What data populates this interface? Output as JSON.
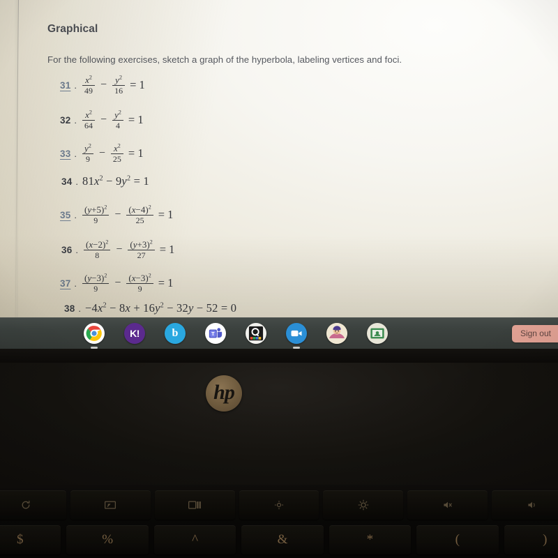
{
  "document": {
    "heading": "Graphical",
    "instruction": "For the following exercises, sketch a graph of the hyperbola, labeling vertices and foci.",
    "exercises": [
      {
        "number": "31",
        "is_link": true,
        "type": "fraction",
        "left": {
          "num": "x²",
          "den": "49",
          "num_var": "x",
          "num_exp": "2"
        },
        "operator": "−",
        "right": {
          "num": "y²",
          "den": "16",
          "num_var": "y",
          "num_exp": "2"
        },
        "rhs": "= 1",
        "latex": "x^2/49 - y^2/16 = 1"
      },
      {
        "number": "32",
        "is_link": false,
        "type": "fraction",
        "left": {
          "num": "x²",
          "den": "64",
          "num_var": "x",
          "num_exp": "2"
        },
        "operator": "−",
        "right": {
          "num": "y²",
          "den": "4",
          "num_var": "y",
          "num_exp": "2"
        },
        "rhs": "= 1",
        "latex": "x^2/64 - y^2/4 = 1"
      },
      {
        "number": "33",
        "is_link": true,
        "type": "fraction",
        "left": {
          "num": "y²",
          "den": "9",
          "num_var": "y",
          "num_exp": "2"
        },
        "operator": "−",
        "right": {
          "num": "x²",
          "den": "25",
          "num_var": "x",
          "num_exp": "2"
        },
        "rhs": "= 1",
        "latex": "y^2/9 - x^2/25 = 1"
      },
      {
        "number": "34",
        "is_link": false,
        "type": "plain",
        "expression": "81x² − 9y² = 1",
        "latex": "81x^2 - 9y^2 = 1"
      },
      {
        "number": "35",
        "is_link": true,
        "type": "fraction",
        "left": {
          "num": "(y+5)²",
          "den": "9",
          "num_base": "(y+5)",
          "num_exp": "2"
        },
        "operator": "−",
        "right": {
          "num": "(x−4)²",
          "den": "25",
          "num_base": "(x−4)",
          "num_exp": "2"
        },
        "rhs": "= 1",
        "latex": "(y+5)^2/9 - (x-4)^2/25 = 1"
      },
      {
        "number": "36",
        "is_link": false,
        "type": "fraction",
        "left": {
          "num": "(x−2)²",
          "den": "8",
          "num_base": "(x−2)",
          "num_exp": "2"
        },
        "operator": "−",
        "right": {
          "num": "(y+3)²",
          "den": "27",
          "num_base": "(y+3)",
          "num_exp": "2"
        },
        "rhs": "= 1",
        "latex": "(x-2)^2/8 - (y+3)^2/27 = 1"
      },
      {
        "number": "37",
        "is_link": true,
        "type": "fraction",
        "left": {
          "num": "(y−3)²",
          "den": "9",
          "num_base": "(y−3)",
          "num_exp": "2"
        },
        "operator": "−",
        "right": {
          "num": "(x−3)²",
          "den": "9",
          "num_base": "(x−3)",
          "num_exp": "2"
        },
        "rhs": "= 1",
        "latex": "(y-3)^2/9 - (x-3)^2/9 = 1"
      },
      {
        "number": "38",
        "is_link": false,
        "type": "plain",
        "expression": "−4x² − 8x + 16y² − 32y − 52 = 0",
        "latex": "-4x^2 - 8x + 16y^2 - 32y - 52 = 0"
      }
    ]
  },
  "shelf": {
    "apps": [
      {
        "name": "chrome-icon",
        "label": "Chrome",
        "running": true
      },
      {
        "name": "kahoot-icon",
        "label": "Kahoot!",
        "glyph": "K!",
        "running": false
      },
      {
        "name": "bitmoji-icon",
        "label": "Bitmoji",
        "glyph": "b",
        "running": false
      },
      {
        "name": "microsoft-teams-icon",
        "label": "Microsoft Teams",
        "running": false
      },
      {
        "name": "quizlet-icon",
        "label": "Quizlet",
        "glyph": "Q",
        "running": false
      },
      {
        "name": "zoom-icon",
        "label": "Zoom",
        "running": true
      },
      {
        "name": "avatar-icon",
        "label": "Avatar",
        "running": false
      },
      {
        "name": "google-classroom-icon",
        "label": "Google Classroom",
        "running": false
      }
    ],
    "sign_out_label": "Sign out"
  },
  "laptop": {
    "brand": "hp",
    "function_keys": [
      {
        "name": "reload-key",
        "label": "⟳"
      },
      {
        "name": "fullscreen-key",
        "label": ""
      },
      {
        "name": "overview-key",
        "label": ""
      },
      {
        "name": "brightness-down-key",
        "label": ""
      },
      {
        "name": "brightness-up-key",
        "label": ""
      },
      {
        "name": "mute-key",
        "label": ""
      },
      {
        "name": "volume-down-key",
        "label": ""
      }
    ],
    "number_row_symbols": [
      "$",
      "%",
      "^",
      "&",
      "*",
      "(",
      ")"
    ]
  },
  "colors": {
    "paper_light": "#fdfdfb",
    "paper_warm": "#ded8c7",
    "text": "#33353a",
    "link": "#6f7f94",
    "shelf": "#3b413e",
    "sign_out_bg": "#e2a294",
    "hp_logo": "#6f5b3e"
  }
}
